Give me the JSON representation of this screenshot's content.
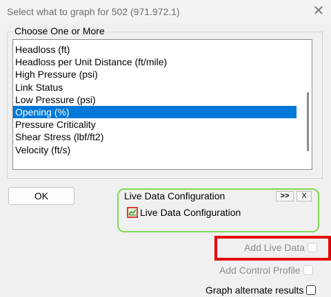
{
  "window": {
    "title": "Select what to graph for 502 (971.972.1)",
    "close_glyph": "✕"
  },
  "group": {
    "legend": "Choose One or More",
    "items": [
      {
        "label": "Headloss (ft)",
        "selected": false
      },
      {
        "label": "Headloss per Unit Distance (ft/mile)",
        "selected": false
      },
      {
        "label": "High Pressure (psi)",
        "selected": false
      },
      {
        "label": "Link Status",
        "selected": false
      },
      {
        "label": "Low Pressure (psi)",
        "selected": false
      },
      {
        "label": "Opening (%)",
        "selected": true
      },
      {
        "label": "Pressure Criticality",
        "selected": false
      },
      {
        "label": "Shear Stress (lbf/ft2)",
        "selected": false
      },
      {
        "label": "Velocity (ft/s)",
        "selected": false
      }
    ]
  },
  "buttons": {
    "ok_label": "OK"
  },
  "live_data": {
    "title": "Live Data Configuration",
    "expand_label": ">>",
    "close_label": "X",
    "item_label": "Live Data Configuration",
    "item_icon": "live-data-icon"
  },
  "options": {
    "add_live_data": {
      "label": "Add Live Data",
      "enabled": false,
      "checked": false
    },
    "add_control_profile": {
      "label": "Add Control Profile",
      "enabled": false,
      "checked": false
    },
    "graph_alternate": {
      "label": "Graph alternate results",
      "enabled": true,
      "checked": false
    }
  },
  "colors": {
    "selection": "#0078d7",
    "live_border": "#7ed957",
    "highlight": "#e60000"
  }
}
